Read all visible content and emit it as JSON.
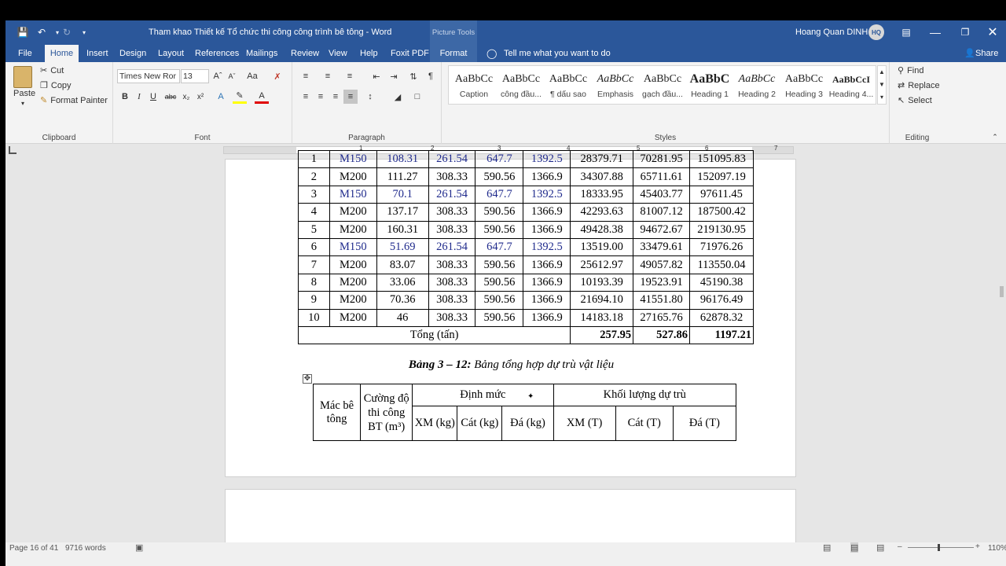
{
  "window": {
    "title": "Tham khao Thiết kế Tổ chức thi công công trình bê tông  -  Word",
    "context_tool": "Picture Tools",
    "user": "Hoang Quan DINH",
    "avatar_initials": "HQ"
  },
  "tabs": [
    "File",
    "Home",
    "Insert",
    "Design",
    "Layout",
    "References",
    "Mailings",
    "Review",
    "View",
    "Help",
    "Foxit PDF",
    "Format"
  ],
  "active_tab": "Home",
  "tell_me": "Tell me what you want to do",
  "share": "Share",
  "ribbon": {
    "clipboard": {
      "paste": "Paste",
      "cut": "Cut",
      "copy": "Copy",
      "format_painter": "Format Painter",
      "label": "Clipboard"
    },
    "font": {
      "name": "Times New Ror",
      "size": "13",
      "label": "Font"
    },
    "paragraph": {
      "label": "Paragraph"
    },
    "styles": {
      "label": "Styles",
      "items": [
        {
          "preview": "AaBbCc",
          "name": "Caption"
        },
        {
          "preview": "AaBbCc",
          "name": "công đầu..."
        },
        {
          "preview": "AaBbCc",
          "name": "¶ dấu sao"
        },
        {
          "preview": "AaBbCc",
          "name": "Emphasis"
        },
        {
          "preview": "AaBbCc",
          "name": "gạch đầu..."
        },
        {
          "preview": "AaBbC",
          "name": "Heading 1"
        },
        {
          "preview": "AaBbCc",
          "name": "Heading 2"
        },
        {
          "preview": "AaBbCc",
          "name": "Heading 3"
        },
        {
          "preview": "AaBbCcI",
          "name": "Heading 4..."
        }
      ]
    },
    "editing": {
      "find": "Find",
      "replace": "Replace",
      "select": "Select",
      "label": "Editing"
    }
  },
  "ruler_numbers": [
    "1",
    "2",
    "3",
    "4",
    "5",
    "6",
    "7"
  ],
  "table1": {
    "partial_row": [
      "1",
      "M150",
      "108.31",
      "261.54",
      "647.7",
      "1392.5",
      "28379.71",
      "70281.95",
      "151095.83"
    ],
    "rows": [
      [
        "2",
        "M200",
        "111.27",
        "308.33",
        "590.56",
        "1366.9",
        "34307.88",
        "65711.61",
        "152097.19"
      ],
      [
        "3",
        "M150",
        "70.1",
        "261.54",
        "647.7",
        "1392.5",
        "18333.95",
        "45403.77",
        "97611.45"
      ],
      [
        "4",
        "M200",
        "137.17",
        "308.33",
        "590.56",
        "1366.9",
        "42293.63",
        "81007.12",
        "187500.42"
      ],
      [
        "5",
        "M200",
        "160.31",
        "308.33",
        "590.56",
        "1366.9",
        "49428.38",
        "94672.67",
        "219130.95"
      ],
      [
        "6",
        "M150",
        "51.69",
        "261.54",
        "647.7",
        "1392.5",
        "13519.00",
        "33479.61",
        "71976.26"
      ],
      [
        "7",
        "M200",
        "83.07",
        "308.33",
        "590.56",
        "1366.9",
        "25612.97",
        "49057.82",
        "113550.04"
      ],
      [
        "8",
        "M200",
        "33.06",
        "308.33",
        "590.56",
        "1366.9",
        "10193.39",
        "19523.91",
        "45190.38"
      ],
      [
        "9",
        "M200",
        "70.36",
        "308.33",
        "590.56",
        "1366.9",
        "21694.10",
        "41551.80",
        "96176.49"
      ],
      [
        "10",
        "M200",
        "46",
        "308.33",
        "590.56",
        "1366.9",
        "14183.18",
        "27165.76",
        "62878.32"
      ]
    ],
    "total_label": "Tổng (tấn)",
    "totals": [
      "257.95",
      "527.86",
      "1197.21"
    ]
  },
  "caption": {
    "bold": "Bảng 3 – 12:",
    "text": " Bảng tổng hợp dự trù vật liệu"
  },
  "table2": {
    "h_mac": "Mác bê tông",
    "h_cuong": "Cường độ thi công BT (m³)",
    "h_dinhmuc": "Định mức",
    "h_khoiluong": "Khối lượng dự trù",
    "h_xm": "XM (kg)",
    "h_cat": "Cát (kg)",
    "h_da": "Đá (kg)",
    "h_xmt": "XM (T)",
    "h_catt": "Cát (T)",
    "h_dat": "Đá (T)"
  },
  "status": {
    "page": "Page 16 of 41",
    "words": "9716 words",
    "zoom": "110%"
  }
}
